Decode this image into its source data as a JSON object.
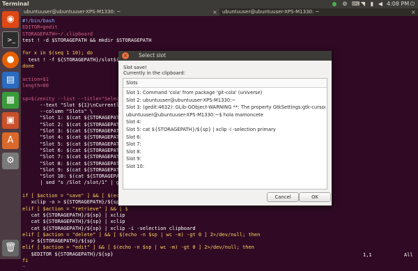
{
  "panel": {
    "app_title": "Terminal",
    "clock": "4:08 PM",
    "indicators": [
      "chrome-icon",
      "settings-gear-icon",
      "keyboard-icon",
      "wifi-icon",
      "battery-icon",
      "volume-icon"
    ]
  },
  "launcher": {
    "items": [
      "ubuntu-dash-icon",
      "terminal-icon",
      "firefox-icon",
      "libreoffice-writer-icon",
      "libreoffice-calc-icon",
      "libreoffice-impress-icon",
      "software-center-icon",
      "system-settings-icon",
      "trash-icon"
    ]
  },
  "tabs": [
    {
      "label": "ubuntuuser@ubuntuuser-XPS-M1330: ~",
      "close": "×"
    },
    {
      "label": "ubuntuuser@ubuntuuser-XPS-M1330: ~",
      "close": "×"
    }
  ],
  "terminal": {
    "lines": [
      "#!/bin/bash",
      "EDITOR=gedit",
      "STORAGEPATH=~/.clipboard",
      "test ! -d $STORAGEPATH && mkdir $STORAGEPATH",
      "",
      "for x in $(seq 1 10); do",
      "  test ! -f ${STORAGEPATH}/slot${x}",
      "done",
      "",
      "action=$1",
      "length=80",
      "",
      "sp=$(zenity --list --title=\"Select",
      "      --text \"Slot ${1}\\nCurrentl",
      "      --column \"Slots\" \\",
      "      \"Slot 1: $(cat ${STORAGEPATH}/",
      "      \"Slot 2: $(cat ${STORAGEPATH}/",
      "      \"Slot 3: $(cat ${STORAGEPATH}/",
      "      \"Slot 4: $(cat ${STORAGEPATH}/",
      "      \"Slot 5: $(cat ${STORAGEPATH}/",
      "      \"Slot 6: $(cat ${STORAGEPATH}/",
      "      \"Slot 7: $(cat ${STORAGEPATH}/",
      "      \"Slot 8: $(cat ${STORAGEPATH}/",
      "      \"Slot 9: $(cat ${STORAGEPATH}/",
      "      \"Slot 10: $(cat ${STORAGEPATH}",
      "      | sed \"s /Slot /slot/1\" | gr",
      "",
      "if [ $action = \"save\" ] && [ $(echo",
      "   xclip -o > ${STORAGEPATH}/${sp}",
      "elif [ $action = \"retrieve\" ] && [ $",
      "   cat ${STORAGEPATH}/${sp} | xclip",
      "   cat ${STORAGEPATH}/${sp} | xclip",
      "   cat ${STORAGEPATH}/${sp} | xclip -i -selection clipboard",
      "elif [ $action = \"delete\" ] && [ $(echo -n $sp | wc -m) -gt 0 ] 2>/dev/null; then",
      "   > ${STORAGEPATH}/${sp}",
      "elif [ $action = \"edit\" ] && [ $(echo -n $sp | wc -m) -gt 0 ] 2>/dev/null; then",
      "   $EDITOR ${STORAGEPATH}/${sp}",
      "fi",
      "~"
    ],
    "cursor_position": "1,1",
    "scroll_position": "All"
  },
  "dialog": {
    "close_glyph": "×",
    "title": "Select slot",
    "heading": "Slot save!",
    "subheading": "Currently in the clipboard:",
    "column_header": "Slots",
    "rows": [
      "Slot 1: Command 'cola' from package 'git-cola' (universe)",
      "Slot 2: ubuntuuser@ubuntuuser-XPS-M1330:~",
      "Slot 3: (gedit:4632): GLib-GObject-WARNING **: The property GtkSettings:gtk-cursor-blink",
      "ubuntuuser@ubuntuuser-XPS-M1330:~$ hola mamoncete",
      "Slot 4:",
      "Slot 5:  cat ${STORAGEPATH}/${sp} | xclip -i -selection primary",
      "Slot 6:",
      "Slot 7:",
      "Slot 8:",
      "Slot 9:",
      "Slot 10:"
    ],
    "cancel_label": "Cancel",
    "ok_label": "OK"
  },
  "colors": {
    "terminal_bg": "#300a24",
    "panel_bg": "#3c3b37",
    "accent_orange": "#dd4814"
  }
}
